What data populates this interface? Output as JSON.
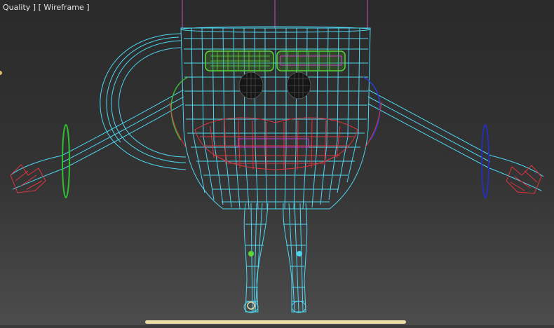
{
  "viewport": {
    "label": "Quality ] [ Wireframe ]",
    "background_top": "#2a2a2a",
    "background_bottom": "#4d4d4d"
  },
  "scene": {
    "object": "cup-character",
    "colors": {
      "body_wire": "#4fd6f2",
      "brows": "#58d63a",
      "brow_inner": "#d23cd6",
      "mouth": "#e0343f",
      "cheek_left": "#3fb83a",
      "cheek_right": "#2b3fd6",
      "hand_left": "#e0343f",
      "ring_left": "#2fbf2f",
      "ring_right": "#2430b8",
      "guide_line": "#c24fc2",
      "eyes": "#1a1a1a",
      "floor_bar": "#e9dca4"
    }
  }
}
